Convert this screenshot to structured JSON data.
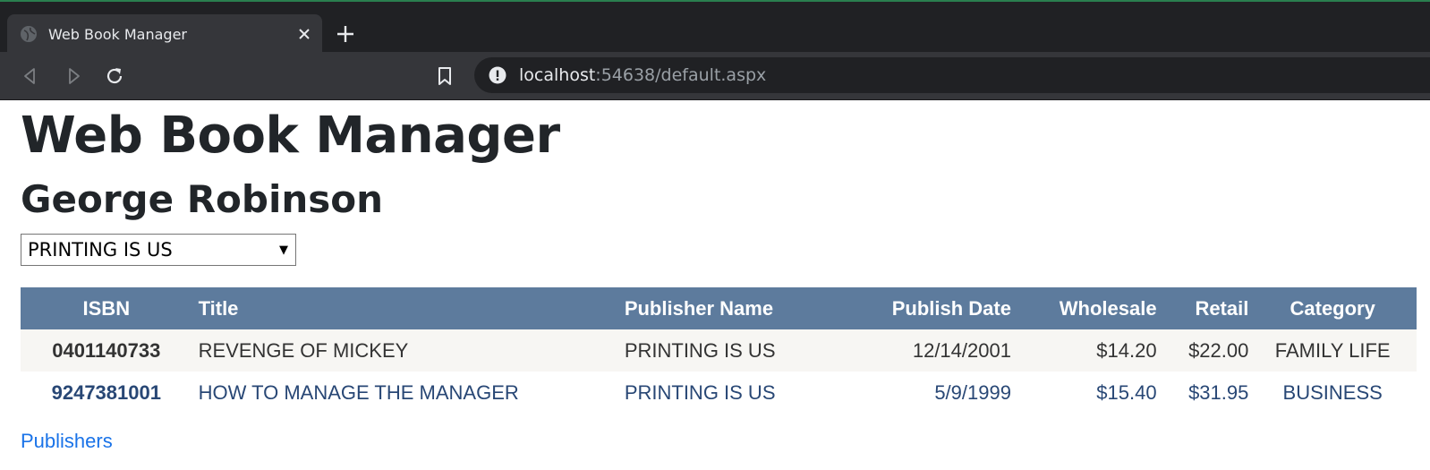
{
  "browser": {
    "tab_title": "Web Book Manager",
    "url_host": "localhost",
    "url_rest": ":54638/default.aspx"
  },
  "page": {
    "title": "Web Book Manager",
    "user_name": "George Robinson",
    "publisher_select": {
      "selected": "PRINTING IS US"
    },
    "table": {
      "columns": [
        "ISBN",
        "Title",
        "Publisher Name",
        "Publish Date",
        "Wholesale",
        "Retail",
        "Category"
      ],
      "rows": [
        [
          "0401140733",
          "REVENGE OF MICKEY",
          "PRINTING IS US",
          "12/14/2001",
          "$14.20",
          "$22.00",
          "FAMILY LIFE"
        ],
        [
          "9247381001",
          "HOW TO MANAGE THE MANAGER",
          "PRINTING IS US",
          "5/9/1999",
          "$15.40",
          "$31.95",
          "BUSINESS"
        ]
      ]
    },
    "publishers_link": "Publishers"
  },
  "colors": {
    "header_bg": "#5d7b9d",
    "row_alt_bg": "#f7f6f3",
    "row_text_dark": "#333333",
    "row_text_blue": "#284775",
    "link": "#1a73e8"
  },
  "icons": [
    "globe-icon",
    "close-icon",
    "plus-icon",
    "back-icon",
    "forward-icon",
    "reload-icon",
    "bookmark-icon",
    "info-icon",
    "dropdown-arrow-icon"
  ]
}
